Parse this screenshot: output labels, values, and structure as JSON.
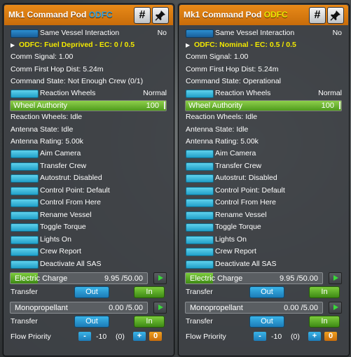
{
  "panels": [
    {
      "title": "Mk1 Command Pod",
      "tag": "ODFC",
      "tag_color": "#2ea0e0",
      "same_vessel_label": "Same Vessel Interaction",
      "same_vessel_value": "No",
      "odfc_status": "ODFC: Fuel Deprived - EC: 0 / 0.5",
      "comm_signal": "Comm Signal: 1.00",
      "comm_hop": "Comm First Hop Dist: 5.24m",
      "command_state": "Command State: Not Enough Crew (0/1)",
      "reaction_wheels_label": "Reaction Wheels",
      "reaction_wheels_value": "Normal",
      "wheel_authority_label": "Wheel Authority",
      "wheel_authority_value": "100",
      "rw_status": "Reaction Wheels: Idle",
      "antenna_state": "Antenna State: Idle",
      "antenna_rating": "Antenna Rating: 5.00k",
      "actions": [
        "Aim Camera",
        "Transfer Crew",
        "Autostrut: Disabled",
        "Control Point: Default",
        "Control From Here",
        "Rename Vessel",
        "Toggle Torque",
        "Lights On",
        "Crew Report",
        "Deactivate All SAS"
      ],
      "electric_name": "Electric Charge",
      "electric_value": "9.95 /50.00",
      "electric_fill": 0.199,
      "transfer_label": "Transfer",
      "out_label": "Out",
      "in_label": "In",
      "mono_name": "Monopropellant",
      "mono_value": "0.00 /5.00",
      "mono_fill": 0,
      "transfer2_label": "Transfer",
      "flow_label": "Flow Priority",
      "flow_minus": "-",
      "flow_value": "-10",
      "flow_paren": "(0)",
      "flow_plus": "+",
      "flow_zero": "0"
    },
    {
      "title": "Mk1 Command Pod",
      "tag": "ODFC",
      "tag_color": "#e8e800",
      "same_vessel_label": "Same Vessel Interaction",
      "same_vessel_value": "No",
      "odfc_status": "ODFC: Nominal - EC: 0.5 / 0.5",
      "comm_signal": "Comm Signal: 1.00",
      "comm_hop": "Comm First Hop Dist: 5.24m",
      "command_state": "Command State: Operational",
      "reaction_wheels_label": "Reaction Wheels",
      "reaction_wheels_value": "Normal",
      "wheel_authority_label": "Wheel Authority",
      "wheel_authority_value": "100",
      "rw_status": "Reaction Wheels: Idle",
      "antenna_state": "Antenna State: Idle",
      "antenna_rating": "Antenna Rating: 5.00k",
      "actions": [
        "Aim Camera",
        "Transfer Crew",
        "Autostrut: Disabled",
        "Control Point: Default",
        "Control From Here",
        "Rename Vessel",
        "Toggle Torque",
        "Lights On",
        "Crew Report",
        "Deactivate All SAS"
      ],
      "electric_name": "Electric Charge",
      "electric_value": "9.95 /50.00",
      "electric_fill": 0.199,
      "transfer_label": "Transfer",
      "out_label": "Out",
      "in_label": "In",
      "mono_name": "Monopropellant",
      "mono_value": "0.00 /5.00",
      "mono_fill": 0,
      "transfer2_label": "Transfer",
      "flow_label": "Flow Priority",
      "flow_minus": "-",
      "flow_value": "-10",
      "flow_paren": "(0)",
      "flow_plus": "+",
      "flow_zero": "0"
    }
  ],
  "icons": {
    "hash": "hash-icon",
    "pin": "pin-icon",
    "expand": "triangle-right-icon",
    "play": "play-icon"
  }
}
